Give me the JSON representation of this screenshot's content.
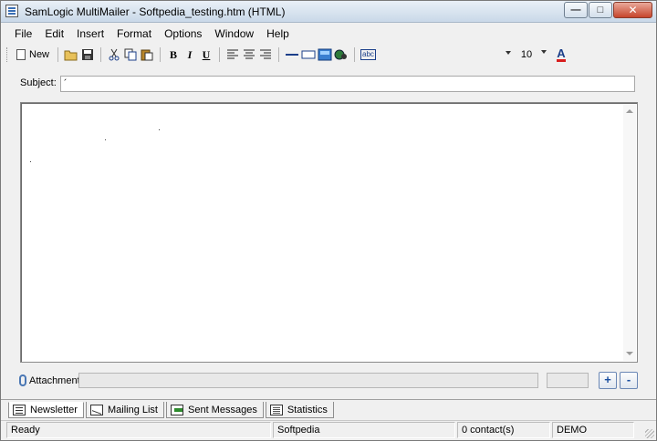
{
  "window": {
    "title": "SamLogic MultiMailer - Softpedia_testing.htm  (HTML)"
  },
  "menu": [
    "File",
    "Edit",
    "Insert",
    "Format",
    "Options",
    "Window",
    "Help"
  ],
  "toolbar": {
    "new_label": "New",
    "bold": "B",
    "italic": "I",
    "underline": "U",
    "font_name": "",
    "font_size": "10",
    "font_color": "A",
    "spellcheck": "abc",
    "font_color_hex": "#d81e1e"
  },
  "subject": {
    "label": "Subject:",
    "value": "´"
  },
  "editor": {
    "content": ""
  },
  "attachment": {
    "label": "Attachment:",
    "value": "",
    "add": "+",
    "remove": "-"
  },
  "tabs": [
    {
      "label": "Newsletter",
      "icon": "newsletter-icon",
      "active": true
    },
    {
      "label": "Mailing List",
      "icon": "mailing-list-icon",
      "active": false
    },
    {
      "label": "Sent Messages",
      "icon": "sent-messages-icon",
      "active": false
    },
    {
      "label": "Statistics",
      "icon": "statistics-icon",
      "active": false
    }
  ],
  "status": {
    "state": "Ready",
    "user": "Softpedia",
    "contacts": "0 contact(s)",
    "mode": "DEMO"
  }
}
